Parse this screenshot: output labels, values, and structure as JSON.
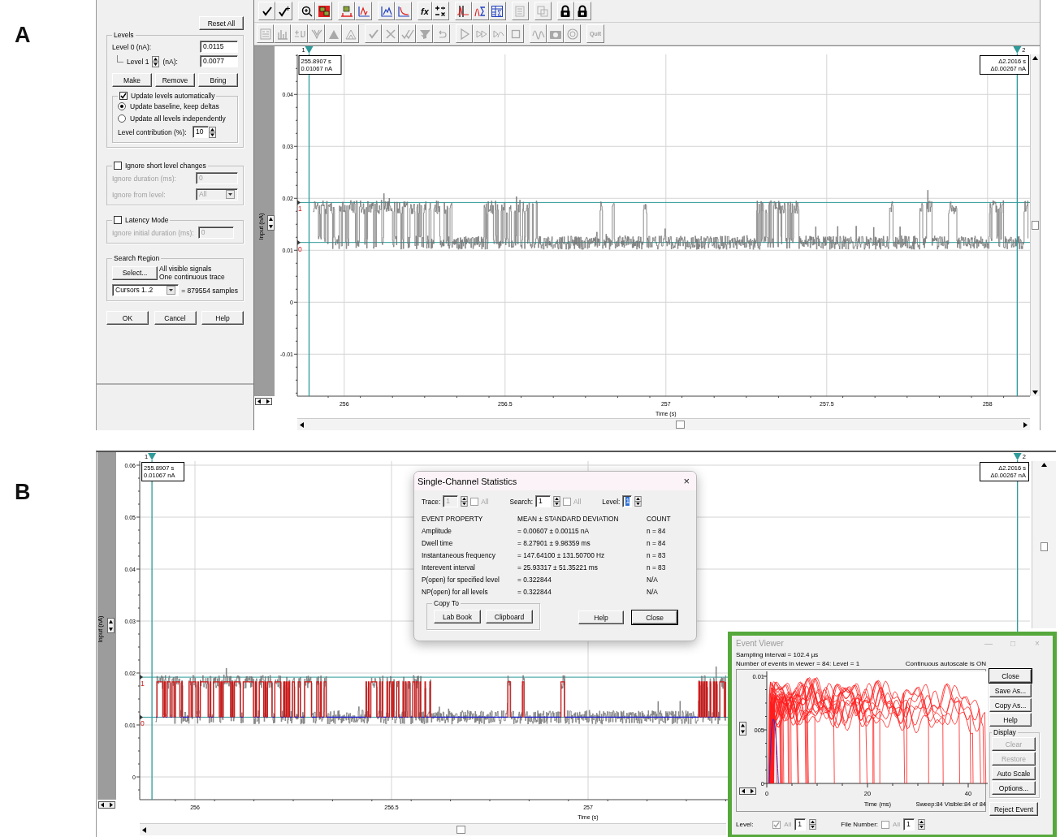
{
  "panel_labels": [
    "A",
    "B"
  ],
  "panel_a": {
    "toolbar": {
      "rows": [
        {
          "disabled": false,
          "text_button": "fx"
        },
        {
          "disabled": true,
          "text_button": "Quit"
        }
      ]
    },
    "dialog": {
      "reset_button": "Reset All",
      "levels": {
        "title": "Levels",
        "level_0_label": "Level 0 (nA):",
        "level_0_value": "0.0115",
        "level_1_label": "Level 1",
        "level_1_unit": "(nA):",
        "level_1_value": "0.0077",
        "buttons": [
          "Make",
          "Remove",
          "Bring"
        ]
      },
      "update": {
        "label": "Update levels automatically",
        "checked": true,
        "options": [
          {
            "label": "Update baseline, keep deltas",
            "selected": true
          },
          {
            "label": "Update all levels independently",
            "selected": false
          }
        ],
        "contribution_label": "Level contribution (%):",
        "contribution_value": "10"
      },
      "ignore_short": {
        "label": "Ignore short level changes",
        "checked": false,
        "duration_label": "Ignore duration (ms):",
        "duration_value": "0",
        "from_label": "Ignore from level:",
        "from_value": "All"
      },
      "latency": {
        "label": "Latency Mode",
        "checked": false,
        "initial_label": "Ignore initial duration (ms):",
        "initial_value": "0"
      },
      "search_region": {
        "title": "Search Region",
        "select_button": "Select...",
        "info": [
          "All visible signals",
          "One continuous trace"
        ],
        "range_value": "Cursors 1..2",
        "samples": "= 879554 samples"
      },
      "footer_buttons": [
        "OK",
        "Cancel",
        "Help"
      ]
    },
    "plot": {
      "y_label": "Input (nA)",
      "y_ticks": [
        "0.04",
        "0.03",
        "0.02",
        "0.01",
        "0",
        "-0.01"
      ],
      "x_ticks": [
        "256",
        "256.5",
        "257",
        "257.5",
        "258"
      ],
      "x_label": "Time (s)",
      "level_markers": [
        "1",
        "0"
      ],
      "cursors": [
        {
          "label": "1",
          "readout": [
            "255.8907 s",
            "0.01067 nA"
          ]
        },
        {
          "label": "2",
          "readout": [
            "Δ2.2016 s",
            "Δ0.00267 nA"
          ]
        }
      ]
    }
  },
  "panel_b": {
    "plot": {
      "y_label": "Input (nA)",
      "y_ticks": [
        "0.06",
        "0.05",
        "0.04",
        "0.03",
        "0.02",
        "0.01",
        "0"
      ],
      "x_ticks": [
        "256",
        "256.5",
        "257"
      ],
      "x_label": "Time (s)",
      "level_markers": [
        "1",
        "0"
      ],
      "cursors": [
        {
          "label": "1",
          "readout": [
            "255.8907 s",
            "0.01067 nA"
          ]
        },
        {
          "label": "2",
          "readout": [
            "Δ2.2016 s",
            "Δ0.00267 nA"
          ]
        }
      ]
    },
    "stats_dialog": {
      "title": "Single-Channel Statistics",
      "close": "×",
      "controls": [
        {
          "label": "Trace:",
          "value": "1",
          "disabled": true,
          "all_label": "All",
          "all_checked": false
        },
        {
          "label": "Search:",
          "value": "1",
          "disabled": false,
          "all_label": "All",
          "all_checked": false
        },
        {
          "label": "Level:",
          "value": "1",
          "disabled": false,
          "selected": true
        }
      ],
      "columns": [
        "EVENT PROPERTY",
        "MEAN ± STANDARD DEVIATION",
        "COUNT"
      ],
      "rows": [
        [
          "Amplitude",
          "= 0.00607 ± 0.00115 nA",
          "n = 84"
        ],
        [
          "Dwell time",
          "= 8.27901 ± 9.98359 ms",
          "n = 84"
        ],
        [
          "Instantaneous frequency",
          "= 147.64100 ± 131.50700 Hz",
          "n = 83"
        ],
        [
          "Interevent interval",
          "= 25.93317 ± 51.35221 ms",
          "n = 83"
        ],
        [
          "P(open) for specified level",
          "= 0.322844",
          "N/A"
        ],
        [
          "NP(open) for all levels",
          "= 0.322844",
          "N/A"
        ]
      ],
      "copy_to": {
        "title": "Copy To",
        "buttons": [
          "Lab Book",
          "Clipboard"
        ]
      },
      "buttons": [
        {
          "label": "Help",
          "default": false
        },
        {
          "label": "Close",
          "default": true
        }
      ]
    },
    "event_viewer": {
      "title": "Event Viewer",
      "active": false,
      "window_controls": [
        "—",
        "□",
        "×"
      ],
      "sampling": "Sampling interval = 102.4 µs",
      "events_info": "Number of events in viewer = 84:  Level = 1",
      "autoscale": "Continuous autoscale is ON",
      "y_ticks": [
        "0.01",
        "005",
        "0"
      ],
      "x_ticks": [
        "0",
        "20",
        "40"
      ],
      "x_label": "Time (ms)",
      "sweep_info": "Sweep:84 Visible:84 of 84",
      "buttons": [
        {
          "label": "Close",
          "disabled": false
        },
        {
          "label": "Save As...",
          "disabled": false
        },
        {
          "label": "Copy As...",
          "disabled": false
        },
        {
          "label": "Help",
          "disabled": false
        }
      ],
      "display_group": {
        "title": "Display",
        "buttons": [
          {
            "label": "Clear",
            "disabled": true
          },
          {
            "label": "Restore",
            "disabled": true
          },
          {
            "label": "Auto Scale",
            "disabled": false
          },
          {
            "label": "Options...",
            "disabled": false
          }
        ]
      },
      "reject_button": "Reject Event",
      "level": {
        "label": "Level:",
        "all_label": "All",
        "all_checked": true,
        "value": "1"
      },
      "file_number": {
        "label": "File Number:",
        "all_label": "All",
        "all_checked": false,
        "value": "1"
      }
    }
  }
}
